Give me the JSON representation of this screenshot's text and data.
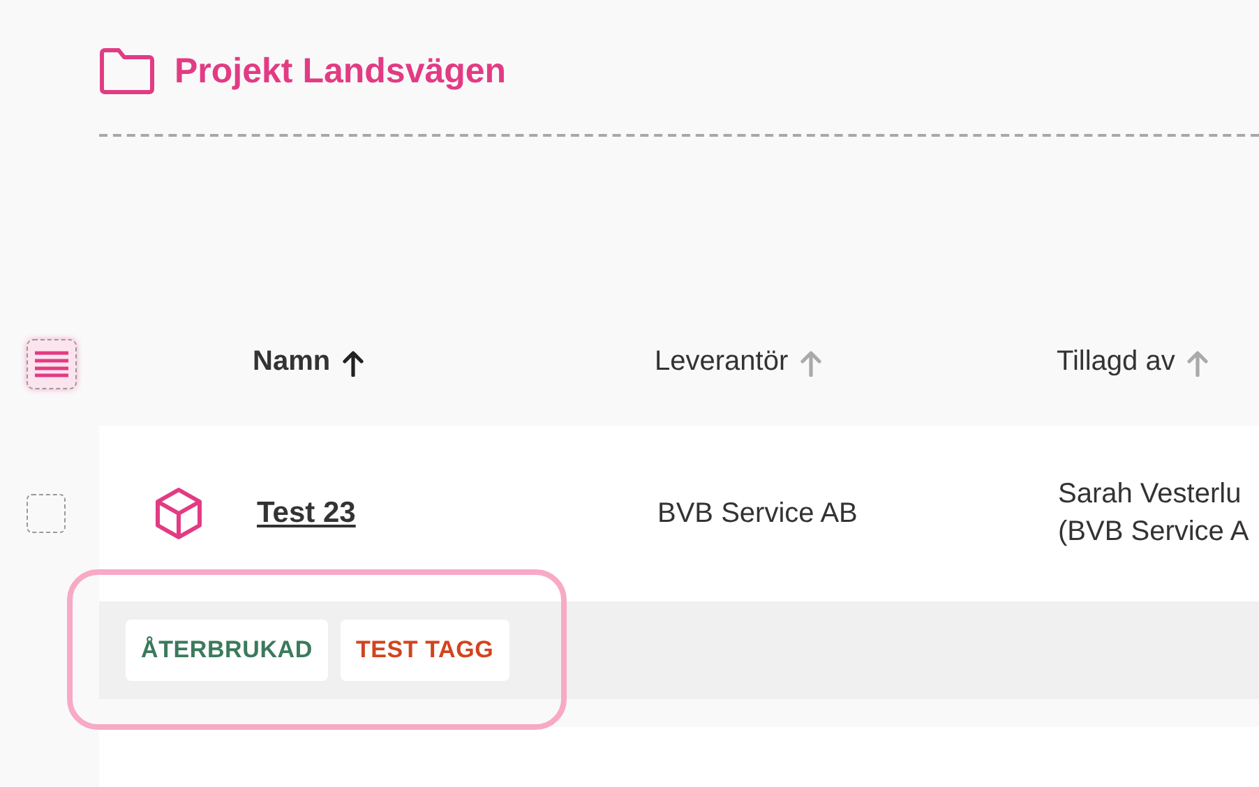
{
  "project": {
    "title": "Projekt Landsvägen"
  },
  "table": {
    "columns": [
      {
        "label": "Namn",
        "sorted": true
      },
      {
        "label": "Leverantör",
        "sorted": false
      },
      {
        "label": "Tillagd av",
        "sorted": false
      }
    ],
    "rows": [
      {
        "checked": false,
        "name": "Test 23",
        "supplier": "BVB Service AB",
        "added_by": [
          "Sarah Vesterlu",
          "(BVB Service A"
        ],
        "tags": [
          {
            "label": "ÅTERBRUKAD",
            "color": "#3b7a5c"
          },
          {
            "label": "TEST TAGG",
            "color": "#d2441e"
          }
        ],
        "highlighted": true
      }
    ]
  }
}
